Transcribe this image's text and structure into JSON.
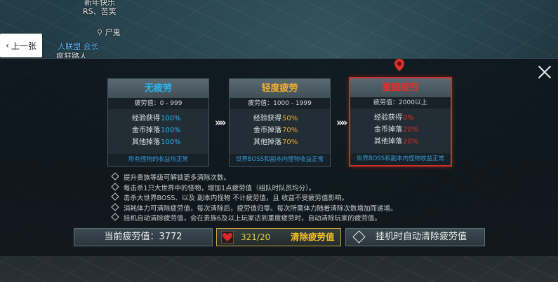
{
  "world": {
    "top_text": "新年快乐",
    "rs_label": "RS、苦笑",
    "npc_name": "尸鬼",
    "alliance": "人联盟 会长",
    "player_name": "疯狂路人"
  },
  "nav": {
    "back_label": "上一张"
  },
  "cards": [
    {
      "title": "无疲劳",
      "title_color": "#27b8f0",
      "value_label": "疲劳值：0 - 999",
      "stats": [
        {
          "label": "经验获得",
          "value": "100%"
        },
        {
          "label": "金币掉落",
          "value": "100%"
        },
        {
          "label": "其他掉落",
          "value": "100%"
        }
      ],
      "value_color": "#27b8f0",
      "footer": "所有怪物的收益均正常"
    },
    {
      "title": "轻度疲劳",
      "title_color": "#f0b030",
      "value_label": "疲劳值：1000 - 1999",
      "stats": [
        {
          "label": "经验获得",
          "value": "50%"
        },
        {
          "label": "金币掉落",
          "value": "70%"
        },
        {
          "label": "其他掉落",
          "value": "70%"
        }
      ],
      "value_color": "#f0b030",
      "footer": "世界BOSS和副本内怪物收益正常"
    },
    {
      "title": "重度疲劳",
      "title_color": "#e0302a",
      "value_label": "疲劳值：2000以上",
      "stats": [
        {
          "label": "经验获得",
          "value": "0%"
        },
        {
          "label": "金币掉落",
          "value": "20%"
        },
        {
          "label": "其他掉落",
          "value": "20%"
        }
      ],
      "value_color": "#e0302a",
      "footer": "世界BOSS和副本内怪物收益正常"
    }
  ],
  "arrow_glyph": "»»",
  "tips": [
    "提升贵族等级可解锁更多清除次数。",
    "每击杀1只大世界中的怪物，增加1点疲劳值（组队时队员均分）。",
    "击杀大世界BOSS、以及 副本内怪物 不计疲劳值，且 收益不受疲劳值影响。",
    "消耗体力可清除疲劳值，每次清除后，疲劳值归零。每次所需体力随着清除次数增加而递增。",
    "挂机自动清除疲劳值，会在贵族6及以上玩家达到重度疲劳时，自动清除玩家的疲劳值。"
  ],
  "bottom": {
    "current_label": "当前疲劳值：3772",
    "stamina": "321/20",
    "clear_label": "清除疲劳值",
    "auto_label": "挂机时自动清除疲劳值"
  },
  "icons": [
    "chevron-left-icon",
    "close-icon",
    "location-pin-icon",
    "heart-icon",
    "diamond-checkbox-icon",
    "double-chevron-icon"
  ]
}
